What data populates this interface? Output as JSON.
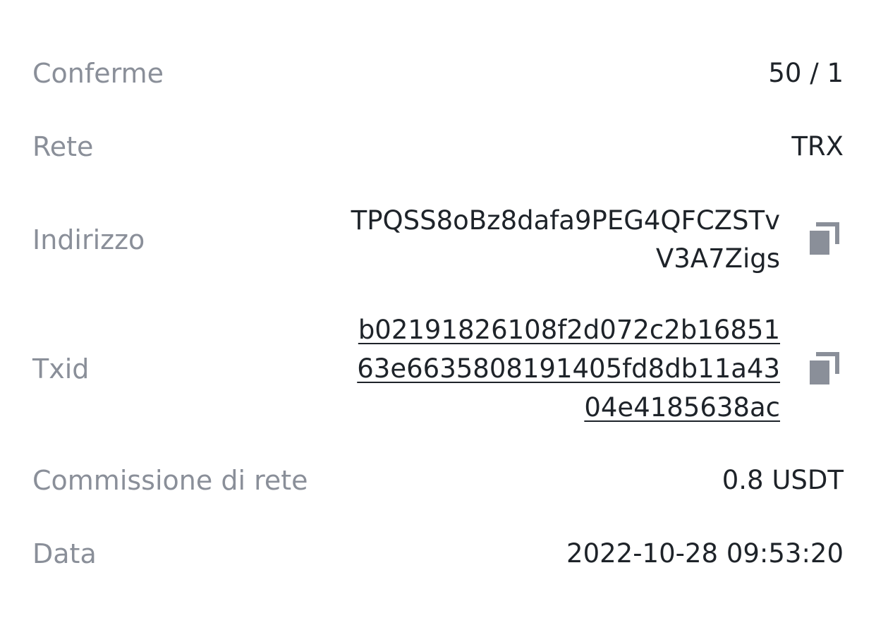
{
  "details": {
    "confirmations": {
      "label": "Conferme",
      "value": "50 / 1"
    },
    "network": {
      "label": "Rete",
      "value": "TRX"
    },
    "address": {
      "label": "Indirizzo",
      "value": "TPQSS8oBz8dafa9PEG4QFCZSTvV3A7Zigs",
      "copy_icon": "copy-icon"
    },
    "txid": {
      "label": "Txid",
      "value": "b02191826108f2d072c2b1685163e6635808191405fd8db11a4304e4185638ac",
      "copy_icon": "copy-icon"
    },
    "network_fee": {
      "label": "Commissione di rete",
      "value": "0.8 USDT"
    },
    "date": {
      "label": "Data",
      "value": "2022-10-28 09:53:20"
    }
  },
  "colors": {
    "label": "#8a8f99",
    "value": "#1e2329",
    "icon": "#8a8f99"
  }
}
